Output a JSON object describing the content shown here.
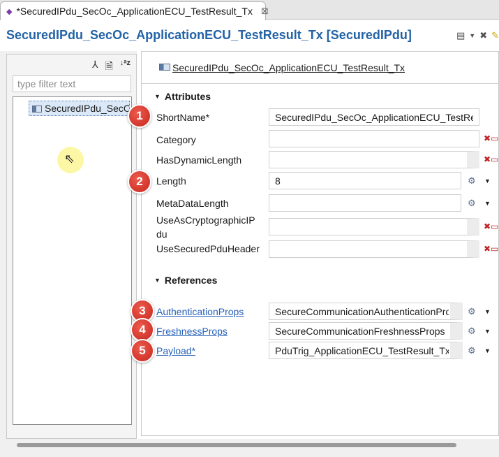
{
  "tab": {
    "title": "*SecuredIPdu_SecOc_ApplicationECU_TestResult_Tx",
    "close_glyph": "⊠"
  },
  "header": {
    "title": "SecuredIPdu_SecOc_ApplicationECU_TestResult_Tx [SecuredIPdu]"
  },
  "left_pane": {
    "filter_placeholder": "type filter text",
    "tree_items": [
      {
        "label": "SecuredIPdu_SecOc_ApplicationECU_TestResult_Tx"
      }
    ]
  },
  "right_pane": {
    "element_title": "SecuredIPdu_SecOc_ApplicationECU_TestResult_Tx",
    "attributes": {
      "header": "Attributes",
      "short_name": {
        "label": "ShortName*",
        "value": "SecuredIPdu_SecOc_ApplicationECU_TestResult_Tx"
      },
      "category": {
        "label": "Category",
        "value": ""
      },
      "has_dynamic_length": {
        "label": "HasDynamicLength",
        "value": ""
      },
      "length": {
        "label": "Length",
        "value": "8"
      },
      "meta_data_length": {
        "label": "MetaDataLength",
        "value": ""
      },
      "use_as_cryptographic_ipdu": {
        "label_line1": "UseAsCryptographicIP",
        "label_line2": "du",
        "value": ""
      },
      "use_secured_pdu_header": {
        "label": "UseSecuredPduHeader",
        "value": ""
      }
    },
    "references": {
      "header": "References",
      "authentication_props": {
        "label": "AuthenticationProps",
        "value": "SecureCommunicationAuthenticationProps"
      },
      "freshness_props": {
        "label": "FreshnessProps",
        "value": "SecureCommunicationFreshnessProps"
      },
      "payload": {
        "label": "Payload*",
        "value": "PduTrig_ApplicationECU_TestResult_Tx"
      }
    }
  },
  "callouts": [
    "1",
    "2",
    "3",
    "4",
    "5"
  ],
  "colors": {
    "header_title": "#2363a6",
    "link": "#2560b8",
    "callout": "#d33a2f",
    "selection": "#dbe8f7"
  }
}
